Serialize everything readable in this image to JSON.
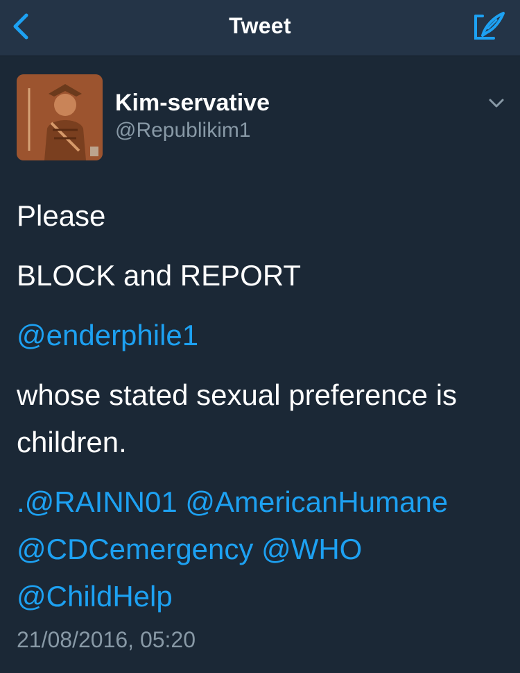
{
  "nav": {
    "title": "Tweet",
    "back_icon": "chevron-left-icon",
    "compose_icon": "compose-tweet-icon"
  },
  "tweet": {
    "author": {
      "name": "Kim-servative",
      "handle": "@Republikim1",
      "avatar": "avatar-image"
    },
    "lines": {
      "l1": "Please",
      "l2": "BLOCK and REPORT",
      "l3": "@enderphile1",
      "l4a": "whose stated sexual preference is",
      "l4b": "children.",
      "l5_prefix": ".",
      "m1": "@RAINN01",
      "m2": "@AmericanHumane",
      "m3": "@CDCemergency",
      "m4": "@WHO",
      "m5": "@ChildHelp"
    },
    "timestamp": "21/08/2016, 05:20"
  },
  "colors": {
    "background": "#1b2836",
    "nav_background": "#243447",
    "link": "#1da1f2",
    "secondary_text": "#8899a6"
  }
}
